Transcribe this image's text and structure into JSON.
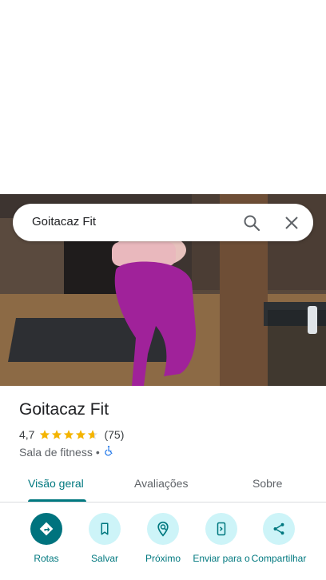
{
  "search": {
    "value": "Goitacaz Fit"
  },
  "place": {
    "name": "Goitacaz Fit",
    "rating": "4,7",
    "rating_value": 4.7,
    "stars_max": 5,
    "review_count": "(75)",
    "category": "Sala de fitness",
    "separator": "•",
    "accessibility_icon": "wheelchair-icon"
  },
  "tabs": [
    {
      "label": "Visão geral",
      "active": true
    },
    {
      "label": "Avaliações",
      "active": false
    },
    {
      "label": "Sobre",
      "active": false
    }
  ],
  "actions": [
    {
      "label": "Rotas",
      "icon": "directions-icon"
    },
    {
      "label": "Salvar",
      "icon": "bookmark-icon"
    },
    {
      "label": "Próximo",
      "icon": "nearby-icon"
    },
    {
      "label": "Enviar para o",
      "icon": "send-to-phone-icon"
    },
    {
      "label": "Compartilhar",
      "icon": "share-icon"
    }
  ],
  "colors": {
    "accent": "#00787f",
    "action_bg": "#cdf4f8",
    "primary_action_bg": "#00737e",
    "star": "#f4b400"
  }
}
